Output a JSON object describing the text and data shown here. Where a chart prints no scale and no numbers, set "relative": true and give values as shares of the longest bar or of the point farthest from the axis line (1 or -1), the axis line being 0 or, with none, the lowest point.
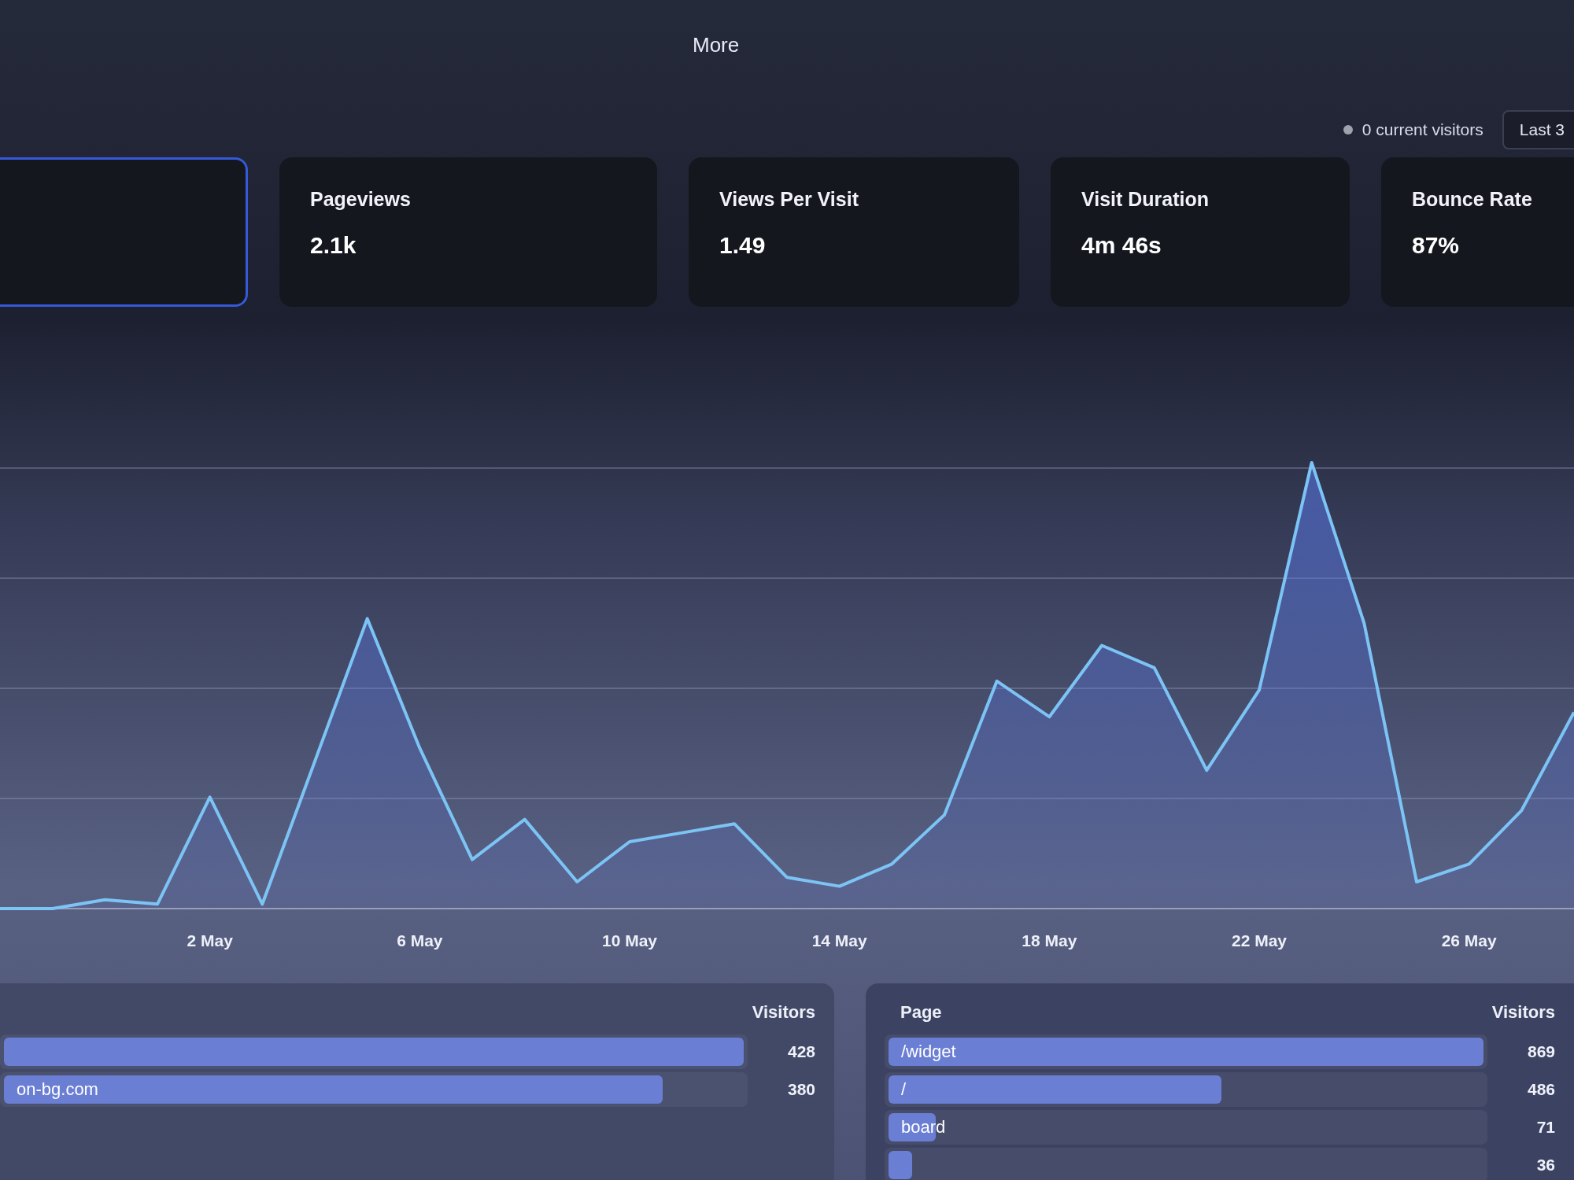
{
  "header": {
    "menu_item": "More"
  },
  "toolbar": {
    "current_visitors": "0 current visitors",
    "period": "Last 3"
  },
  "stats": [
    {
      "selected": true
    },
    {
      "label": "Pageviews",
      "value": "2.1k",
      "selected": false
    },
    {
      "label": "Views Per Visit",
      "value": "1.49",
      "selected": false
    },
    {
      "label": "Visit Duration",
      "value": "4m 46s",
      "selected": false
    },
    {
      "label": "Bounce Rate",
      "value": "87%",
      "selected": false
    }
  ],
  "chart": {
    "chart_data": {
      "type": "area",
      "relative": true,
      "categories": [
        null,
        null,
        null,
        null,
        "2 May",
        null,
        null,
        null,
        "6 May",
        null,
        null,
        null,
        "10 May",
        null,
        null,
        null,
        "14 May",
        null,
        null,
        null,
        "18 May",
        null,
        null,
        null,
        "22 May",
        null,
        null,
        null,
        "26 May",
        null,
        null
      ],
      "values": [
        0,
        0,
        0.02,
        0.01,
        0.25,
        0.01,
        0.33,
        0.65,
        0.36,
        0.11,
        0.2,
        0.06,
        0.15,
        0.17,
        0.19,
        0.07,
        0.05,
        0.1,
        0.21,
        0.51,
        0.43,
        0.59,
        0.54,
        0.31,
        0.49,
        1,
        0.64,
        0.06,
        0.1,
        0.22,
        0.44
      ]
    }
  },
  "sources": {
    "column": "Visitors",
    "rows": [
      {
        "visitors": "428",
        "level": 1
      },
      {
        "label": "on-bg.com",
        "visitors": "380",
        "level": 0.89
      }
    ]
  },
  "pages": {
    "columns": [
      "Page",
      "Visitors"
    ],
    "rows": [
      {
        "label": "/widget",
        "visitors": "869",
        "level": 1
      },
      {
        "label": "/",
        "visitors": "486",
        "level": 0.56
      },
      {
        "label": "board",
        "visitors": "71",
        "level": 0.08
      },
      {
        "visitors": "36",
        "level": 0.04
      }
    ]
  }
}
